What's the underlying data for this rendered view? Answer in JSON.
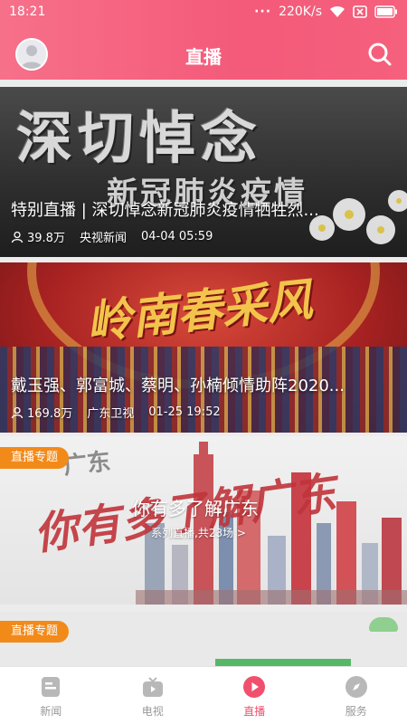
{
  "status_bar": {
    "time": "18:21",
    "dots": "···",
    "net_speed": "220K/s"
  },
  "header": {
    "title": "直播",
    "accent_color": "#f45a7a"
  },
  "feed": {
    "cards": [
      {
        "title": "特别直播 | 深切悼念新冠肺炎疫情牺牲烈...",
        "viewers": "39.8万",
        "source": "央视新闻",
        "datetime": "04-04 05:59",
        "art_main": "深切悼念",
        "art_sub": "新冠肺炎疫情"
      },
      {
        "title": "戴玉强、郭富城、蔡明、孙楠倾情助阵2020...",
        "viewers": "169.8万",
        "source": "广东卫视",
        "datetime": "01-25 19:52",
        "art_main": "岭南春采风"
      },
      {
        "tag": "直播专题",
        "title": "你有多了解广东",
        "subtitle": "系列直播,共23场 >",
        "art_main": "你有多了解广东",
        "art_logo": "广东"
      },
      {
        "tag": "直播专题"
      }
    ]
  },
  "bottom_nav": {
    "items": [
      {
        "label": "新闻",
        "icon": "news-icon",
        "active": false
      },
      {
        "label": "电视",
        "icon": "tv-icon",
        "active": false
      },
      {
        "label": "直播",
        "icon": "play-icon",
        "active": true
      },
      {
        "label": "服务",
        "icon": "compass-icon",
        "active": false
      }
    ],
    "active_color": "#f0506e",
    "inactive_color": "#999999"
  }
}
